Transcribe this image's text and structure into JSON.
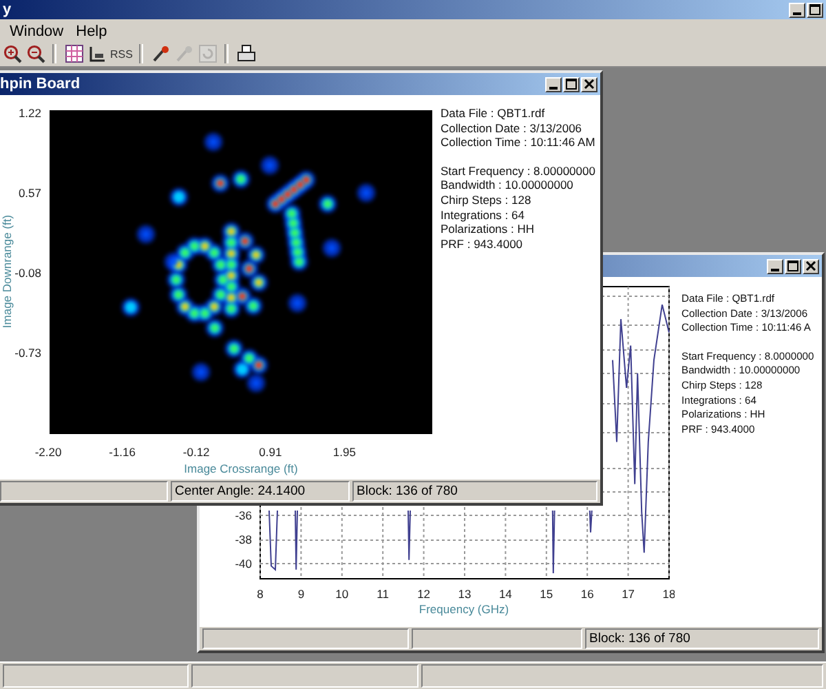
{
  "app": {
    "title": "y"
  },
  "menu": [
    {
      "label": "Window"
    },
    {
      "label": "Help"
    }
  ],
  "toolbar": [
    {
      "kind": "zoom-in",
      "disabled": false
    },
    {
      "kind": "zoom-out",
      "disabled": false
    },
    {
      "kind": "separator"
    },
    {
      "kind": "chart",
      "disabled": false
    },
    {
      "kind": "tool",
      "disabled": false
    },
    {
      "kind": "text",
      "label": "RSS",
      "disabled": false
    },
    {
      "kind": "separator"
    },
    {
      "kind": "wand",
      "disabled": false
    },
    {
      "kind": "wand",
      "disabled": true
    },
    {
      "kind": "refresh",
      "disabled": true
    },
    {
      "kind": "separator"
    },
    {
      "kind": "print",
      "disabled": false
    }
  ],
  "windows": [
    {
      "kind": "image",
      "title": "hpin Board",
      "ylabel": "Image Downrange (ft)",
      "xlabel": "Image Crossrange (ft)",
      "yticks": [
        "1.22",
        "0.57",
        "-0.08",
        "-0.73"
      ],
      "xticks": [
        "-2.20",
        "-1.16",
        "-0.12",
        "0.91",
        "1.95"
      ],
      "info": [
        [
          "Data File : QBT1.rdf",
          "Collection Date : 3/13/2006",
          "Collection Time : 10:11:46 AM"
        ],
        [
          "Start Frequency : 8.00000000",
          "Bandwidth : 10.00000000",
          "Chirp Steps : 128",
          "Integrations : 64",
          "Polarizations : HH",
          "PRF : 943.4000"
        ]
      ],
      "status": [
        "Center Angle: 24.1400",
        "Block: 136 of 780"
      ]
    },
    {
      "kind": "spectrum",
      "chart_data": {
        "type": "line",
        "grid": true,
        "xlabel": "Frequency (GHz)",
        "xlim": [
          8,
          18
        ],
        "ylim": [
          -41.26,
          -17
        ],
        "xticks": [
          8,
          9,
          10,
          11,
          12,
          13,
          14,
          15,
          16,
          17,
          18
        ],
        "yticks": [
          -36,
          -38,
          -40
        ],
        "x": [
          8.22,
          8.27,
          8.37,
          8.42,
          8.86,
          8.88,
          8.91,
          11.62,
          11.64,
          11.67,
          15.15,
          15.17,
          15.2,
          16.06,
          16.08,
          16.11,
          16.62,
          16.72,
          16.82,
          16.96,
          17.06,
          17.16,
          17.23,
          17.33,
          17.39,
          17.49,
          17.63,
          17.83,
          18.0
        ],
        "series": [
          {
            "color": "#404090",
            "values": [
              -35.6,
              -40.2,
              -40.5,
              -35.6,
              -35.6,
              -40.5,
              -35.6,
              -35.6,
              -39.7,
              -35.6,
              -35.6,
              -40.8,
              -35.6,
              -35.6,
              -37.4,
              -35.6,
              -23.1,
              -29.9,
              -19.7,
              -25.4,
              -21.9,
              -33.4,
              -24.2,
              -35.7,
              -39.1,
              -29.9,
              -23.1,
              -18.5,
              -20.8
            ]
          }
        ]
      },
      "info": [
        [
          "Data File : QBT1.rdf",
          "Collection Date : 3/13/2006",
          "Collection Time : 10:11:46 A"
        ],
        [
          "Start Frequency : 8.0000000",
          "Bandwidth : 10.00000000",
          "Chirp Steps : 128",
          "Integrations : 64",
          "Polarizations : HH",
          "PRF : 943.4000"
        ]
      ],
      "status": [
        "Block: 136 of 780"
      ]
    }
  ]
}
